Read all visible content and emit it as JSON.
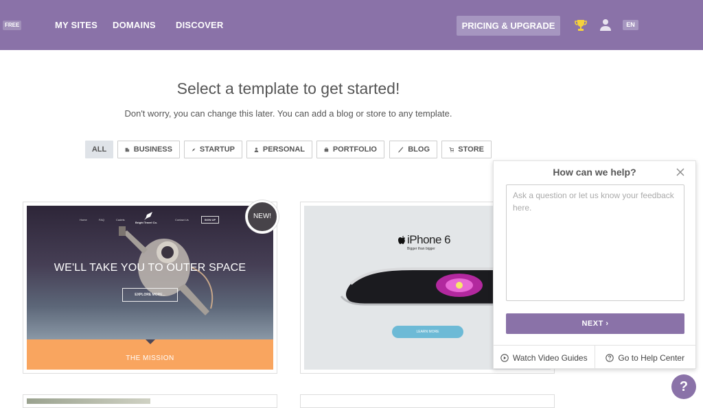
{
  "header": {
    "plan_badge": "FREE",
    "nav": [
      "MY SITES",
      "DOMAINS",
      "DISCOVER"
    ],
    "pricing_label": "PRICING & UPGRADE",
    "lang": "EN",
    "accent": "#8a72a8"
  },
  "main": {
    "heading": "Select a template to get started!",
    "subheading": "Don't worry, you can change this later. You can add a blog or store to any template.",
    "filters": [
      "ALL",
      "BUSINESS",
      "STARTUP",
      "PERSONAL",
      "PORTFOLIO",
      "BLOG",
      "STORE"
    ],
    "active_filter": "ALL"
  },
  "templates": [
    {
      "badge": "NEW!",
      "nav": [
        "Home",
        "FAQ",
        "Cadets",
        "Contact Us"
      ],
      "brand": "Bright Travel Co.",
      "signup": "SIGN UP",
      "title": "WE'LL TAKE YOU TO OUTER SPACE",
      "button": "EXPLORE MORE...",
      "section": "THE MISSION"
    },
    {
      "title": "iPhone 6",
      "subtitle": "Bigger than bigger",
      "button": "LEARN MORE"
    }
  ],
  "help": {
    "title": "How can we help?",
    "placeholder": "Ask a question or let us know your feedback here.",
    "next_label": "NEXT  ›",
    "video_label": "Watch Video Guides",
    "help_center_label": "Go to Help Center",
    "fab": "?"
  }
}
